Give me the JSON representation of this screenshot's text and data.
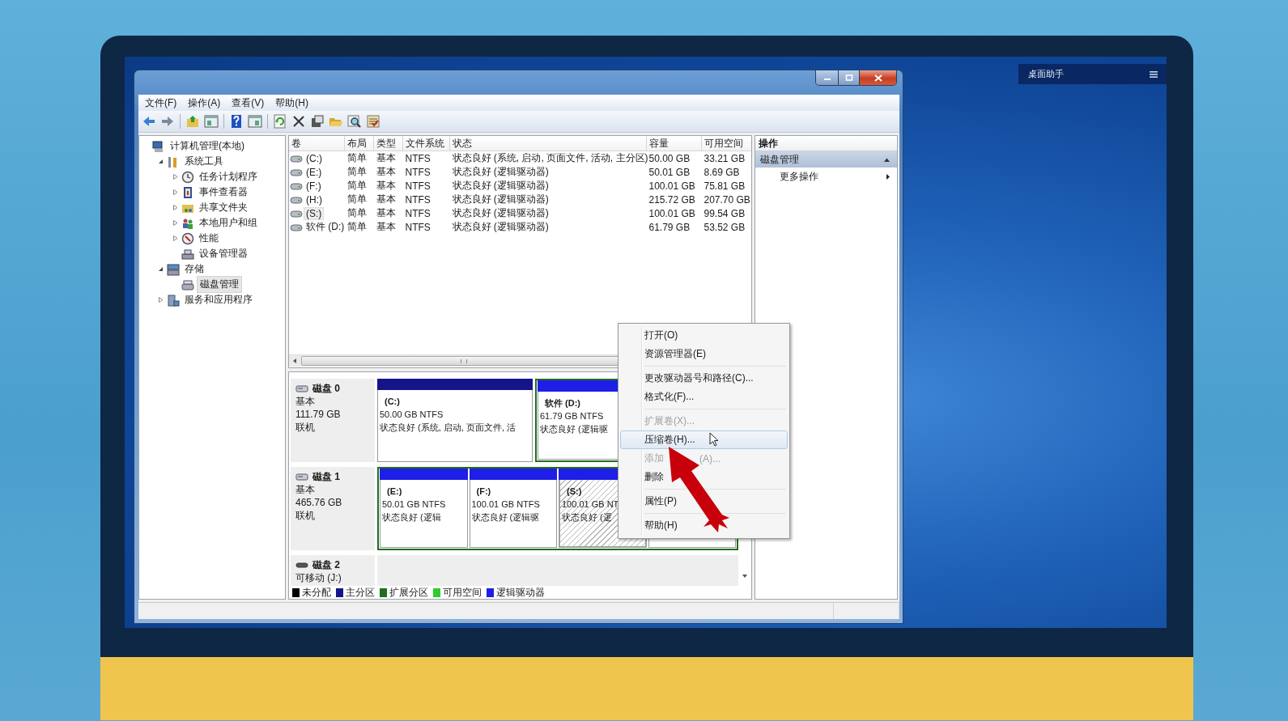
{
  "gadget": {
    "title": "桌面助手"
  },
  "menu_bar": [
    "文件(F)",
    "操作(A)",
    "查看(V)",
    "帮助(H)"
  ],
  "tree": [
    {
      "label": "计算机管理(本地)",
      "selected": false,
      "children": [
        {
          "label": "系统工具",
          "kind": "branch",
          "expanded": true,
          "selected": false,
          "children": [
            {
              "label": "任务计划程序",
              "kind": "branch",
              "expanded": false,
              "selected": false
            },
            {
              "label": "事件查看器",
              "kind": "branch",
              "expanded": false,
              "selected": false
            },
            {
              "label": "共享文件夹",
              "kind": "branch",
              "expanded": false,
              "selected": false
            },
            {
              "label": "本地用户和组",
              "kind": "branch",
              "expanded": false,
              "selected": false
            },
            {
              "label": "性能",
              "kind": "branch",
              "expanded": false,
              "selected": false
            },
            {
              "label": "设备管理器",
              "kind": "leaf",
              "selected": false
            }
          ]
        },
        {
          "label": "存储",
          "kind": "branch",
          "expanded": true,
          "selected": false,
          "children": [
            {
              "label": "磁盘管理",
              "kind": "leaf",
              "selected": true
            }
          ]
        },
        {
          "label": "服务和应用程序",
          "kind": "branch",
          "expanded": false,
          "selected": false
        }
      ]
    }
  ],
  "volume_table": {
    "columns": [
      "卷",
      "布局",
      "类型",
      "文件系统",
      "状态",
      "容量",
      "可用空间"
    ],
    "rows": [
      {
        "cells": [
          "(C:)",
          "简单",
          "基本",
          "NTFS",
          "状态良好 (系统, 启动, 页面文件, 活动, 主分区)",
          "50.00 GB",
          "33.21 GB"
        ],
        "selected": false
      },
      {
        "cells": [
          "(E:)",
          "简单",
          "基本",
          "NTFS",
          "状态良好 (逻辑驱动器)",
          "50.01 GB",
          "8.69 GB"
        ],
        "selected": false
      },
      {
        "cells": [
          "(F:)",
          "简单",
          "基本",
          "NTFS",
          "状态良好 (逻辑驱动器)",
          "100.01 GB",
          "75.81 GB"
        ],
        "selected": false
      },
      {
        "cells": [
          "(H:)",
          "简单",
          "基本",
          "NTFS",
          "状态良好 (逻辑驱动器)",
          "215.72 GB",
          "207.70 GB"
        ],
        "selected": false
      },
      {
        "cells": [
          "(S:)",
          "简单",
          "基本",
          "NTFS",
          "状态良好 (逻辑驱动器)",
          "100.01 GB",
          "99.54 GB"
        ],
        "selected": true
      },
      {
        "cells": [
          "软件 (D:)",
          "简单",
          "基本",
          "NTFS",
          "状态良好 (逻辑驱动器)",
          "61.79 GB",
          "53.52 GB"
        ],
        "selected": false
      }
    ]
  },
  "disks": [
    {
      "name": "磁盘 0",
      "kind": "fixed",
      "type": "基本",
      "size": "111.79 GB",
      "state": "联机",
      "segments": [
        {
          "kind": "primary",
          "partitions": [
            {
              "title": "(C:)",
              "size": "50.00 GB NTFS",
              "status": "状态良好 (系统, 启动, 页面文件, 活",
              "selected": false
            }
          ]
        },
        {
          "kind": "extended",
          "partitions": [
            {
              "title": "软件  (D:)",
              "size": "61.79 GB NTFS",
              "status": "状态良好 (逻辑驱",
              "selected": false
            }
          ]
        }
      ]
    },
    {
      "name": "磁盘 1",
      "kind": "fixed",
      "type": "基本",
      "size": "465.76 GB",
      "state": "联机",
      "segments": [
        {
          "kind": "extended",
          "partitions": [
            {
              "title": "(E:)",
              "size": "50.01 GB NTFS",
              "status": "状态良好 (逻辑",
              "selected": false
            },
            {
              "title": "(F:)",
              "size": "100.01 GB NTFS",
              "status": "状态良好 (逻辑驱",
              "selected": false
            },
            {
              "title": "(S:)",
              "size": "100.01 GB NT",
              "status": "状态良好 (逻",
              "selected": true
            },
            {
              "selected": false
            }
          ]
        }
      ]
    },
    {
      "name": "磁盘 2",
      "kind": "removable",
      "type": "可移动 (J:)"
    }
  ],
  "legend": [
    {
      "label": "未分配",
      "color": "#000000"
    },
    {
      "label": "主分区",
      "color": "#15158a"
    },
    {
      "label": "扩展分区",
      "color": "#1f6e1f"
    },
    {
      "label": "可用空间",
      "color": "#2ecc2e"
    },
    {
      "label": "逻辑驱动器",
      "color": "#1e1ee6"
    }
  ],
  "actions": {
    "title": "操作",
    "section": {
      "label": "磁盘管理",
      "expanded": true
    },
    "items": [
      {
        "label": "更多操作"
      }
    ]
  },
  "context_menu": [
    {
      "kind": "item",
      "label": "打开(O)",
      "disabled": false,
      "selected": false
    },
    {
      "kind": "item",
      "label": "资源管理器(E)",
      "disabled": false,
      "selected": false
    },
    {
      "kind": "separator"
    },
    {
      "kind": "item",
      "label": "更改驱动器号和路径(C)...",
      "disabled": false,
      "selected": false
    },
    {
      "kind": "item",
      "label": "格式化(F)...",
      "disabled": false,
      "selected": false
    },
    {
      "kind": "separator"
    },
    {
      "kind": "item",
      "label": "扩展卷(X)...",
      "disabled": true,
      "selected": false
    },
    {
      "kind": "item",
      "label": "压缩卷(H)...",
      "disabled": false,
      "selected": true
    },
    {
      "kind": "item",
      "label": "添加",
      "label_tail": "(A)...",
      "disabled": true,
      "selected": false
    },
    {
      "kind": "item",
      "label": "删除",
      "disabled": false,
      "selected": false
    },
    {
      "kind": "separator"
    },
    {
      "kind": "item",
      "label": "属性(P)",
      "disabled": false,
      "selected": false
    },
    {
      "kind": "separator"
    },
    {
      "kind": "item",
      "label": "帮助(H)",
      "disabled": false,
      "selected": false
    }
  ]
}
